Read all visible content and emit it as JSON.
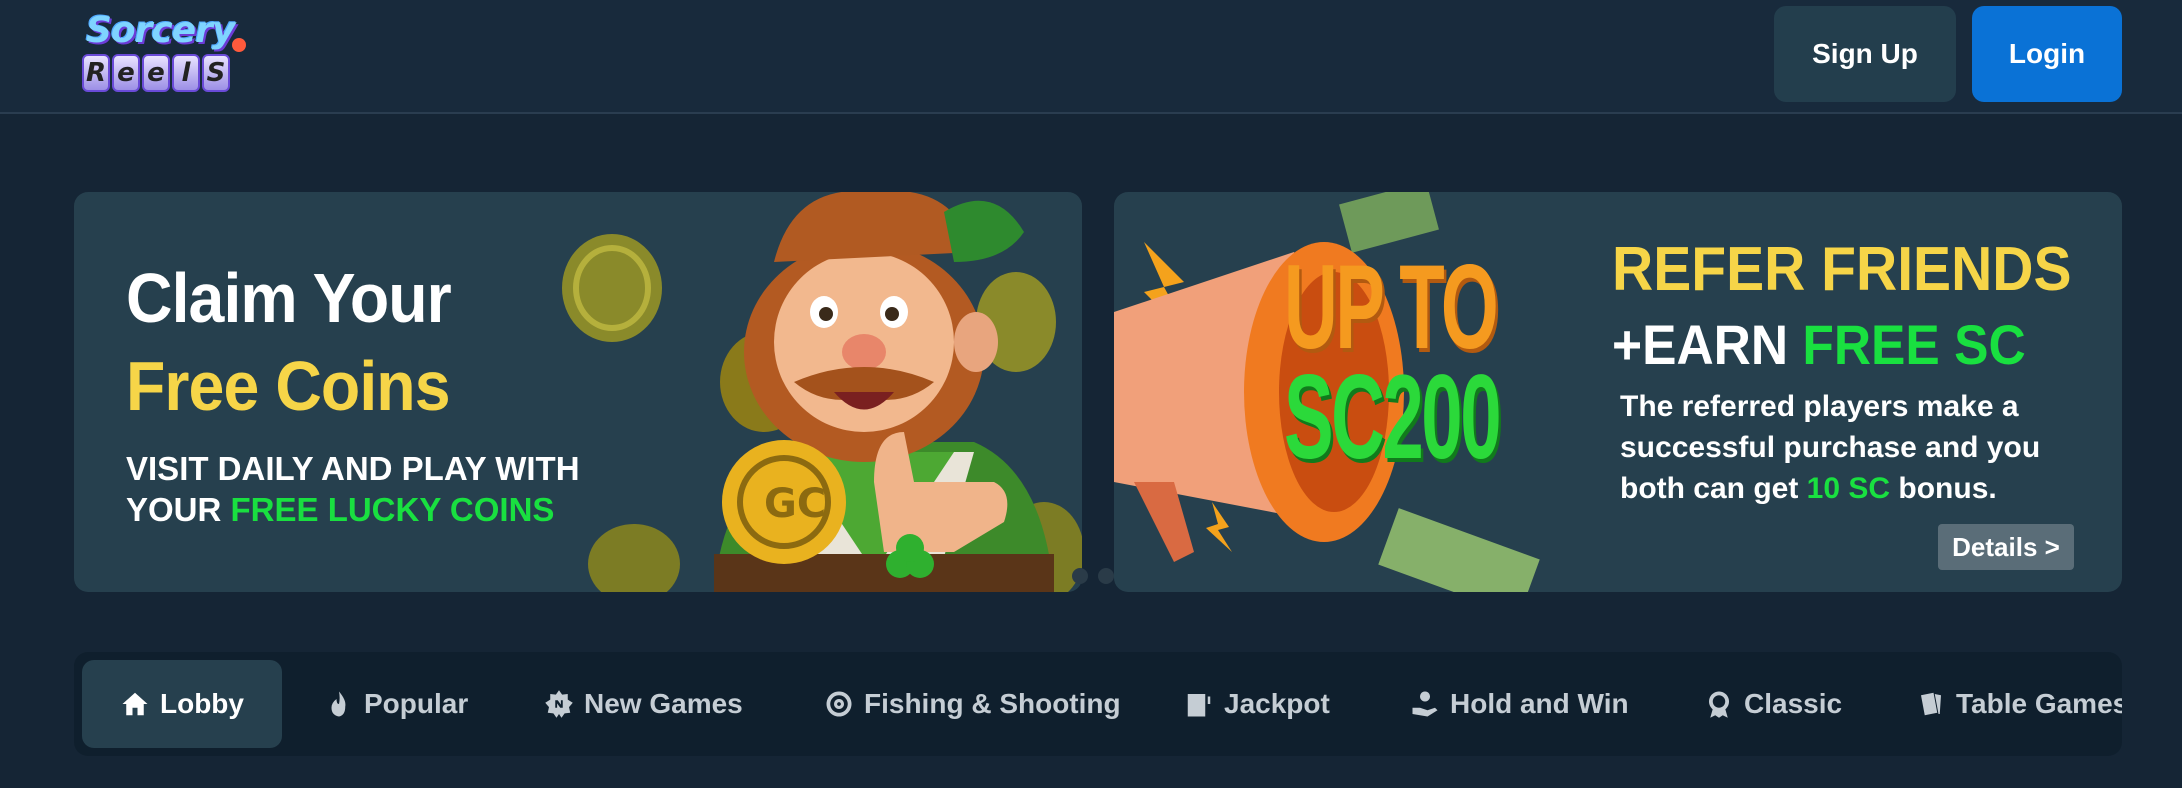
{
  "header": {
    "logo_text_top": "Sorcery",
    "logo_text_bottom": [
      "R",
      "e",
      "e",
      "l",
      "S"
    ],
    "signup_label": "Sign Up",
    "login_label": "Login"
  },
  "banners": {
    "claim": {
      "line1": "Claim Your",
      "line2": "Free Coins",
      "sub_part1": "VISIT DAILY AND PLAY WITH",
      "sub_part2": "YOUR ",
      "sub_highlight": "FREE LUCKY COINS"
    },
    "refer": {
      "title": "REFER FRIENDS",
      "earn_prefix": "+EARN ",
      "earn_highlight": "FREE SC",
      "body_part1": "The referred players make a successful purchase and you both can get ",
      "body_highlight": "10 SC",
      "body_part2": " bonus.",
      "promo_line1": "UP TO",
      "promo_line2": "SC200",
      "details_label": "Details >"
    }
  },
  "categories": [
    {
      "label": "Lobby",
      "icon": "home-icon",
      "active": true
    },
    {
      "label": "Popular",
      "icon": "flame-icon",
      "active": false
    },
    {
      "label": "New Games",
      "icon": "new-badge-icon",
      "active": false
    },
    {
      "label": "Fishing & Shooting",
      "icon": "target-icon",
      "active": false
    },
    {
      "label": "Jackpot",
      "icon": "slot-machine-icon",
      "active": false
    },
    {
      "label": "Hold and Win",
      "icon": "hand-coin-icon",
      "active": false
    },
    {
      "label": "Classic",
      "icon": "medal-icon",
      "active": false
    },
    {
      "label": "Table Games",
      "icon": "cards-icon",
      "active": false
    }
  ],
  "colors": {
    "background": "#152535",
    "accent_blue": "#0a72d6",
    "gold": "#f6d548",
    "green": "#19e040"
  }
}
